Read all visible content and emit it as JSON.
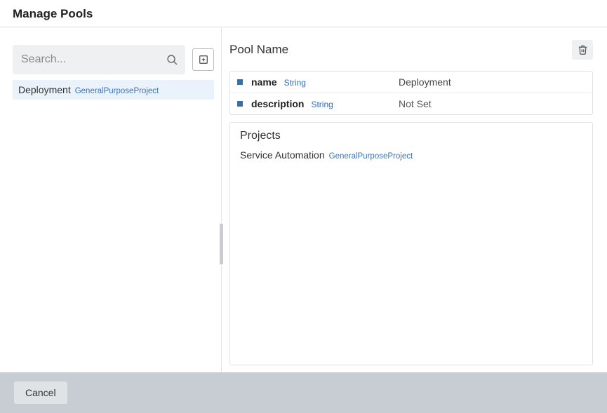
{
  "header": {
    "title": "Manage Pools"
  },
  "sidebar": {
    "search": {
      "placeholder": "Search...",
      "value": ""
    },
    "items": [
      {
        "name": "Deployment",
        "badge": "GeneralPurposeProject",
        "selected": true
      }
    ]
  },
  "details": {
    "heading": "Pool Name",
    "properties": [
      {
        "key": "name",
        "type": "String",
        "value": "Deployment"
      },
      {
        "key": "description",
        "type": "String",
        "value": "Not Set",
        "unset": true
      }
    ],
    "projects": {
      "heading": "Projects",
      "items": [
        {
          "name": "Service Automation",
          "badge": "GeneralPurposeProject"
        }
      ]
    }
  },
  "footer": {
    "cancel_label": "Cancel"
  }
}
